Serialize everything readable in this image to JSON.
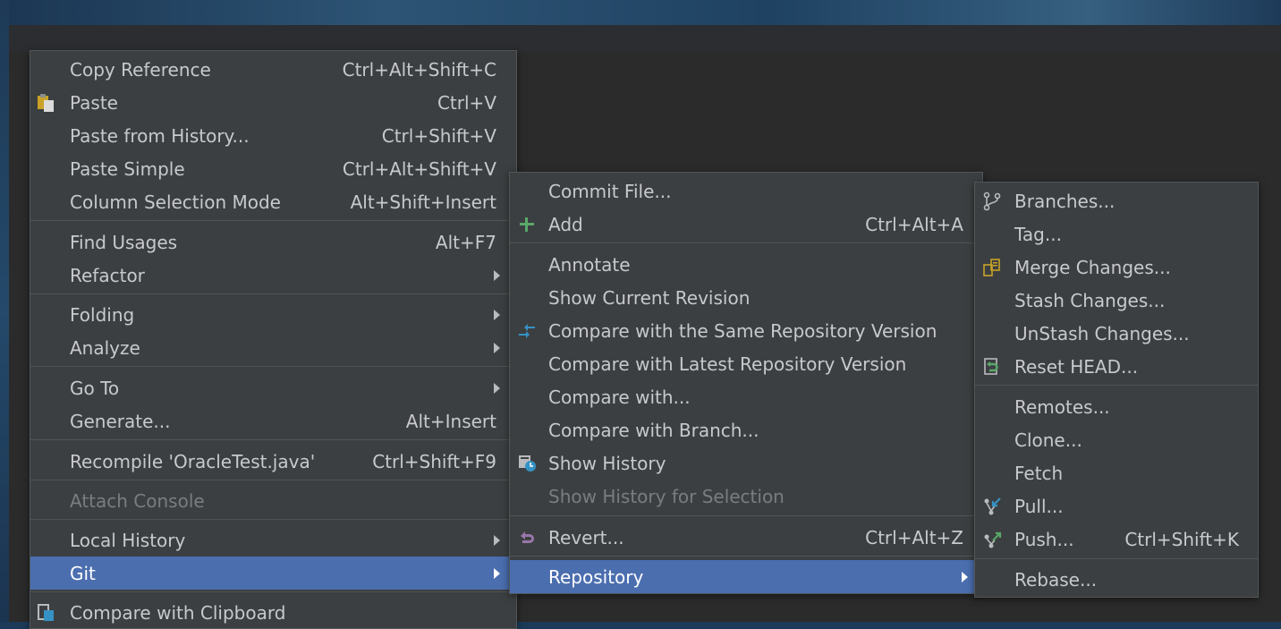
{
  "colors": {
    "menu_bg": "#3c3f41",
    "selected_bg": "#4b6eaf",
    "text": "#c7c9cc",
    "disabled_text": "#7a7d80",
    "editor_bg": "#2b2b2b"
  },
  "menu1": {
    "copy_reference": {
      "label": "Copy Reference",
      "shortcut": "Ctrl+Alt+Shift+C"
    },
    "paste": {
      "label": "Paste",
      "shortcut": "Ctrl+V",
      "icon": "clipboard-paste-icon"
    },
    "paste_from_history": {
      "label": "Paste from History...",
      "shortcut": "Ctrl+Shift+V"
    },
    "paste_simple": {
      "label": "Paste Simple",
      "shortcut": "Ctrl+Alt+Shift+V"
    },
    "column_selection_mode": {
      "label": "Column Selection Mode",
      "shortcut": "Alt+Shift+Insert"
    },
    "find_usages": {
      "label": "Find Usages",
      "shortcut": "Alt+F7"
    },
    "refactor": {
      "label": "Refactor"
    },
    "folding": {
      "label": "Folding"
    },
    "analyze": {
      "label": "Analyze"
    },
    "go_to": {
      "label": "Go To"
    },
    "generate": {
      "label": "Generate...",
      "shortcut": "Alt+Insert"
    },
    "recompile": {
      "label": "Recompile 'OracleTest.java'",
      "shortcut": "Ctrl+Shift+F9"
    },
    "attach_console": {
      "label": "Attach Console"
    },
    "local_history": {
      "label": "Local History"
    },
    "git": {
      "label": "Git"
    },
    "compare_clipboard": {
      "label": "Compare with Clipboard",
      "icon": "compare-clipboard-icon"
    }
  },
  "menu2": {
    "commit_file": {
      "label": "Commit File..."
    },
    "add": {
      "label": "Add",
      "shortcut": "Ctrl+Alt+A",
      "icon": "plus-icon"
    },
    "annotate": {
      "label": "Annotate"
    },
    "show_current_revision": {
      "label": "Show Current Revision"
    },
    "compare_same_repo": {
      "label": "Compare with the Same Repository Version",
      "icon": "compare-arrows-icon"
    },
    "compare_latest_repo": {
      "label": "Compare with Latest Repository Version"
    },
    "compare_with": {
      "label": "Compare with..."
    },
    "compare_with_branch": {
      "label": "Compare with Branch..."
    },
    "show_history": {
      "label": "Show History",
      "icon": "history-icon"
    },
    "show_history_selection": {
      "label": "Show History for Selection"
    },
    "revert": {
      "label": "Revert...",
      "shortcut": "Ctrl+Alt+Z",
      "icon": "revert-icon"
    },
    "repository": {
      "label": "Repository"
    }
  },
  "menu3": {
    "branches": {
      "label": "Branches...",
      "icon": "branch-icon"
    },
    "tag": {
      "label": "Tag..."
    },
    "merge_changes": {
      "label": "Merge Changes...",
      "icon": "merge-icon"
    },
    "stash_changes": {
      "label": "Stash Changes..."
    },
    "unstash_changes": {
      "label": "UnStash Changes..."
    },
    "reset_head": {
      "label": "Reset HEAD...",
      "icon": "reset-icon"
    },
    "remotes": {
      "label": "Remotes..."
    },
    "clone": {
      "label": "Clone..."
    },
    "fetch": {
      "label": "Fetch"
    },
    "pull": {
      "label": "Pull...",
      "icon": "pull-icon"
    },
    "push": {
      "label": "Push...",
      "shortcut": "Ctrl+Shift+K",
      "icon": "push-icon"
    },
    "rebase": {
      "label": "Rebase..."
    }
  }
}
